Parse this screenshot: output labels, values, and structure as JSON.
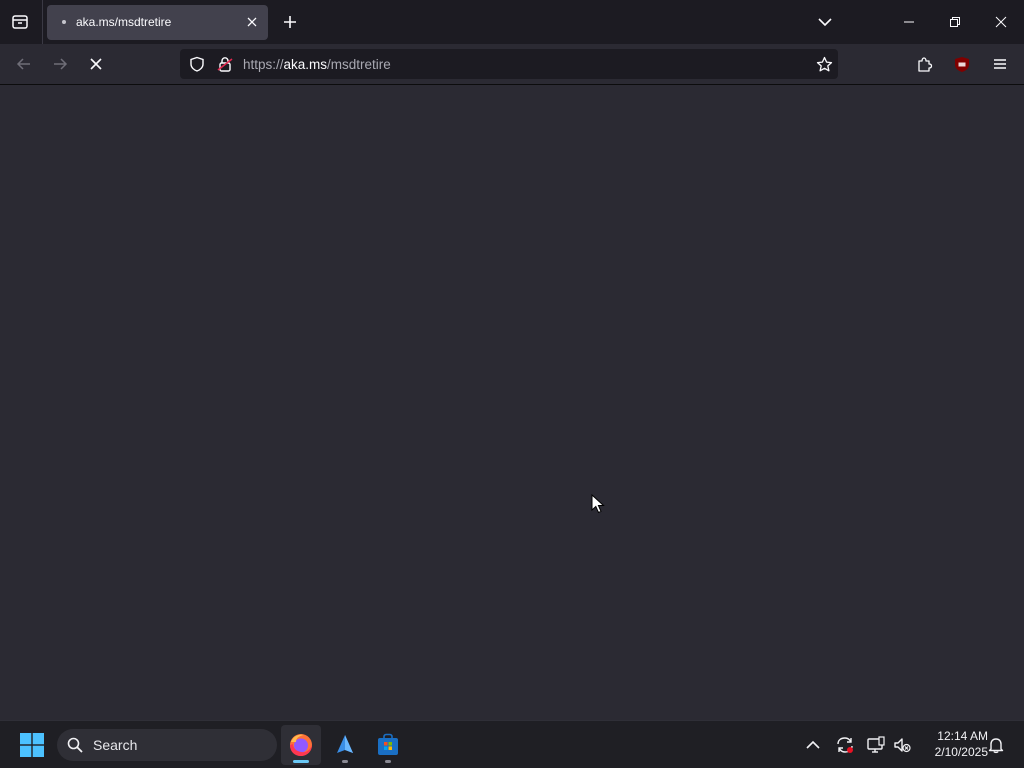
{
  "browser": {
    "tab": {
      "title": "aka.ms/msdtretire"
    },
    "url": {
      "scheme": "https://",
      "host": "aka.ms",
      "path": "/msdtretire"
    }
  },
  "taskbar": {
    "search_label": "Search",
    "clock": {
      "time": "12:14 AM",
      "date": "2/10/2025"
    },
    "apps": [
      "firefox-icon",
      "app-icon",
      "store-icon"
    ]
  },
  "colors": {
    "accent": "#6ac8f5",
    "content_bg": "#2b2a33",
    "tabstrip_bg": "#1c1b22"
  }
}
